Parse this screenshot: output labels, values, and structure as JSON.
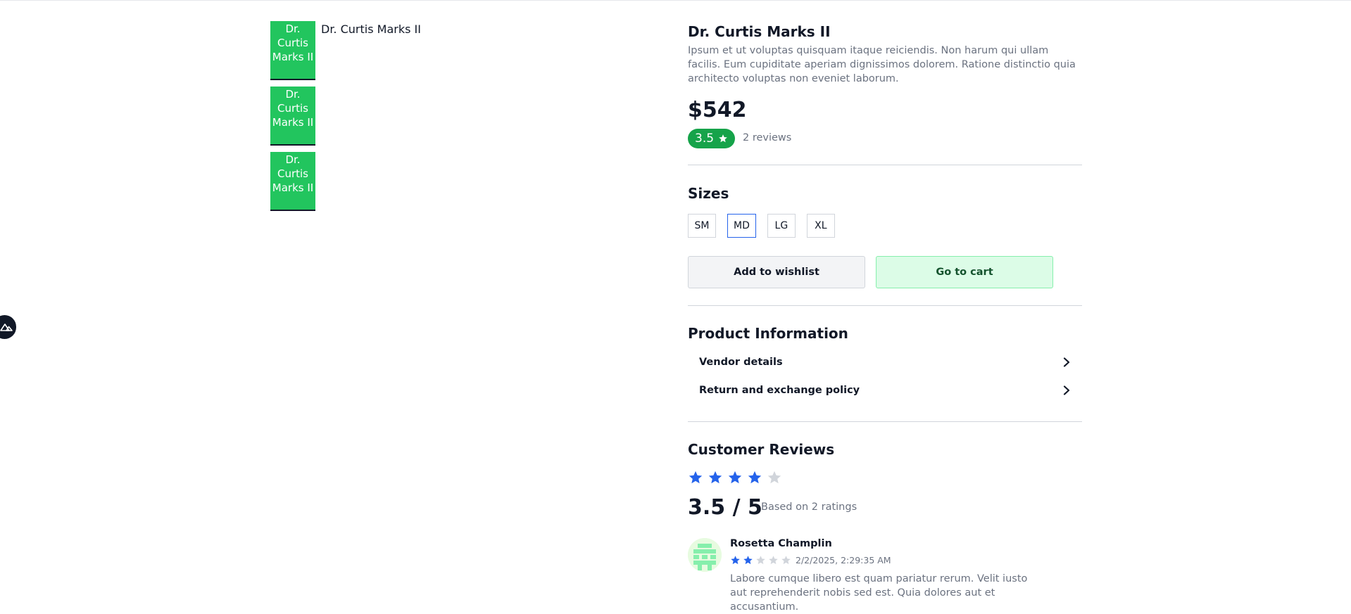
{
  "gallery": {
    "thumbnails": [
      {
        "label": "Dr. Curtis Marks II"
      },
      {
        "label": "Dr. Curtis Marks II"
      },
      {
        "label": "Dr. Curtis Marks II"
      }
    ],
    "main_image_alt": "Dr. Curtis Marks II",
    "thumbnail_color": "#22c55e"
  },
  "product": {
    "title": "Dr. Curtis Marks II",
    "description": "Ipsum et ut voluptas quisquam itaque reiciendis. Non harum qui ullam facilis. Eum cupiditate aperiam dignissimos dolorem. Ratione distinctio quia architecto voluptas non eveniet laborum.",
    "price": "$542",
    "rating": "3.5",
    "review_count": "2 reviews"
  },
  "sizes": {
    "title": "Sizes",
    "options": [
      "SM",
      "MD",
      "LG",
      "XL"
    ],
    "selected": "MD"
  },
  "actions": {
    "wishlist_label": "Add to wishlist",
    "cart_label": "Go to cart"
  },
  "info": {
    "title": "Product Information",
    "items": [
      "Vendor details",
      "Return and exchange policy"
    ]
  },
  "reviews": {
    "title": "Customer Reviews",
    "stars_filled": 4,
    "stars_total": 5,
    "score": "3.5 / 5",
    "based_on": "Based on 2 ratings",
    "list": [
      {
        "name": "Rosetta Champlin",
        "stars": 2,
        "date": "2/2/2025, 2:29:35 AM",
        "text": "Labore cumque libero est quam pariatur rerum. Velit iusto aut reprehenderit nobis sed est. Quia dolores aut et accusantium."
      }
    ]
  },
  "colors": {
    "accent_blue": "#2563eb",
    "rating_green": "#16a34a",
    "star_empty": "#d1d5db"
  },
  "icons": {
    "dev_badge": "nuxt-icon",
    "rating": "star-icon",
    "accordion": "chevron-right-icon"
  }
}
